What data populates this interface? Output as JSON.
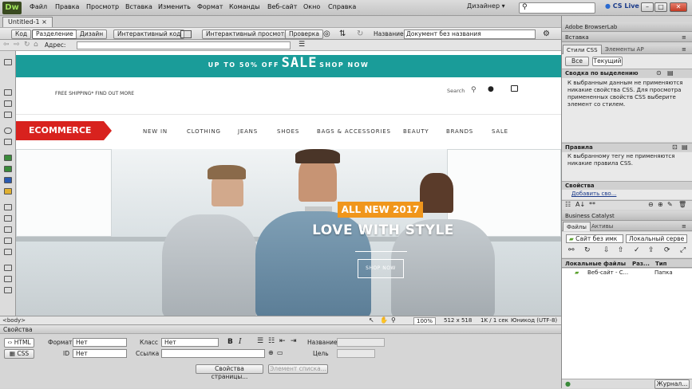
{
  "menubar": {
    "logo": "Dw",
    "items": [
      "Файл",
      "Правка",
      "Просмотр",
      "Вставка",
      "Изменить",
      "Формат",
      "Команды",
      "Веб-сайт",
      "Окно",
      "Справка"
    ],
    "workspace": "Дизайнер",
    "cslive": "CS Live"
  },
  "document": {
    "tab": "Untitled-1",
    "views": [
      "Код",
      "Разделение",
      "Дизайн"
    ],
    "live_code": "Интерактивный код",
    "live_view": "Интерактивный просмотр",
    "inspect": "Проверка",
    "title_label": "Название:",
    "title_value": "Документ без названия",
    "address_label": "Адрес:"
  },
  "site": {
    "promo_small_left": "UP TO 50% OFF",
    "promo_big": "SALE",
    "promo_small_right": "SHOP NOW",
    "shipping": "FREE SHIPPING* FIND OUT MORE",
    "search": "Search",
    "brand": "ECOMMERCE",
    "nav": [
      "NEW IN",
      "CLOTHING",
      "JEANS",
      "SHOES",
      "BAGS & ACCESSORIES",
      "BEAUTY",
      "BRANDS",
      "SALE"
    ],
    "badge": "ALL NEW 2017",
    "tagline": "LOVE WITH STYLE",
    "shop_button": "SHOP NOW"
  },
  "status": {
    "tag": "<body>",
    "zoom": "100%",
    "size": "512 x 518",
    "info": "1K / 1 сек",
    "encoding": "Юникод (UTF-8)"
  },
  "properties": {
    "title": "Свойства",
    "html_btn": "HTML",
    "css_btn": "CSS",
    "format_label": "Формат",
    "format_value": "Нет",
    "id_label": "ID",
    "id_value": "Нет",
    "class_label": "Класс",
    "class_value": "Нет",
    "link_label": "Ссылка",
    "name_label": "Название",
    "target_label": "Цель",
    "page_props": "Свойства страницы...",
    "list_item": "Элемент списка...",
    "bold": "B",
    "italic": "I"
  },
  "right_panel": {
    "browserlab": "Adobe BrowserLab",
    "insert": "Вставка",
    "tabs_css": [
      "Стили CSS",
      "Элементы AP"
    ],
    "all": "Все",
    "current": "Текущий",
    "summary_title": "Сводка по выделению",
    "summary_text": "К выбранным данным не применяются никакие свойства CSS. Для просмотра примененных свойств CSS выберите элемент со стилем.",
    "rules_title": "Правила",
    "rules_text": "К выбранному тегу не применяются никакие правила CSS.",
    "props_title": "Свойства",
    "add_prop": "Добавить сво...",
    "business_catalyst": "Business Catalyst",
    "tabs_files": [
      "Файлы",
      "Активы"
    ],
    "site_select": "Сайт без имк",
    "view_select": "Локальный серве",
    "files_headers": [
      "Локальные файлы",
      "Раз...",
      "Тип"
    ],
    "files_rows": [
      {
        "name": "Веб-сайт - С...",
        "size": "",
        "type": "Папка"
      }
    ],
    "log": "Журнал..."
  },
  "colors": {
    "teal": "#1a9c99",
    "brand_red": "#d8221e",
    "badge_orange": "#f0961c"
  }
}
